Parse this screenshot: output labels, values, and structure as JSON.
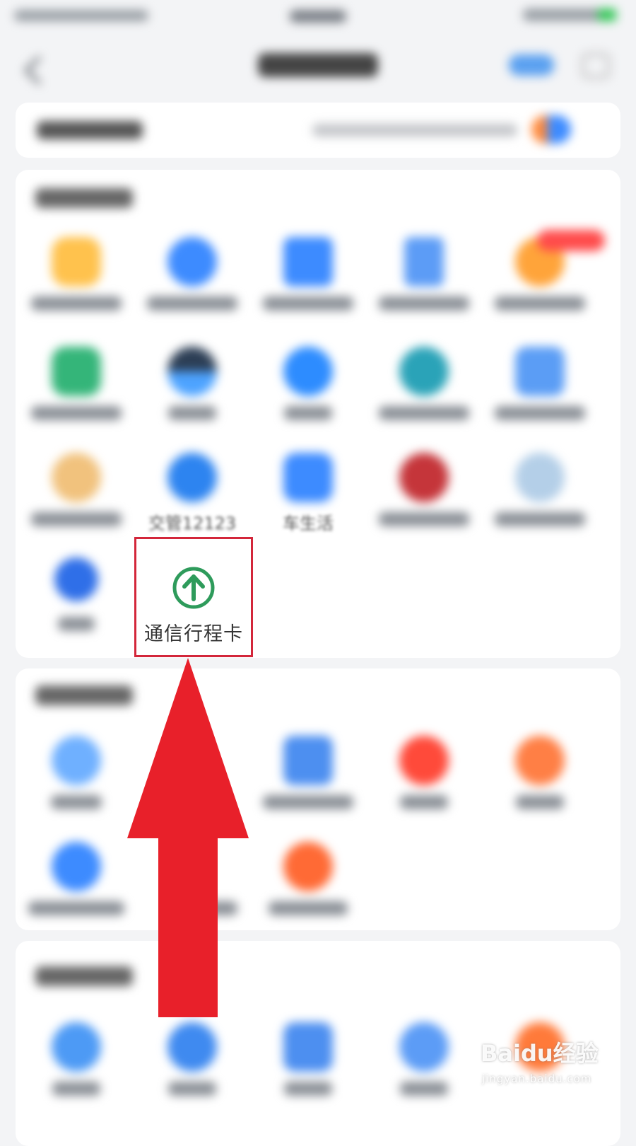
{
  "visible_labels": {
    "traffic_police": "交管12123",
    "car_life": "车生活",
    "highlight": "通信行程卡"
  },
  "watermark": {
    "text": "Baidu经验",
    "sub": "jingyan.baidu.com"
  },
  "colors": {
    "highlight_border": "#d3263a",
    "arrow_red": "#e8202a",
    "itinerary_green": "#2e9b5b",
    "primary_blue": "#3d8bff"
  },
  "icons": {
    "highlight": "arrow-up-circle-icon",
    "pointer": "red-up-arrow"
  }
}
